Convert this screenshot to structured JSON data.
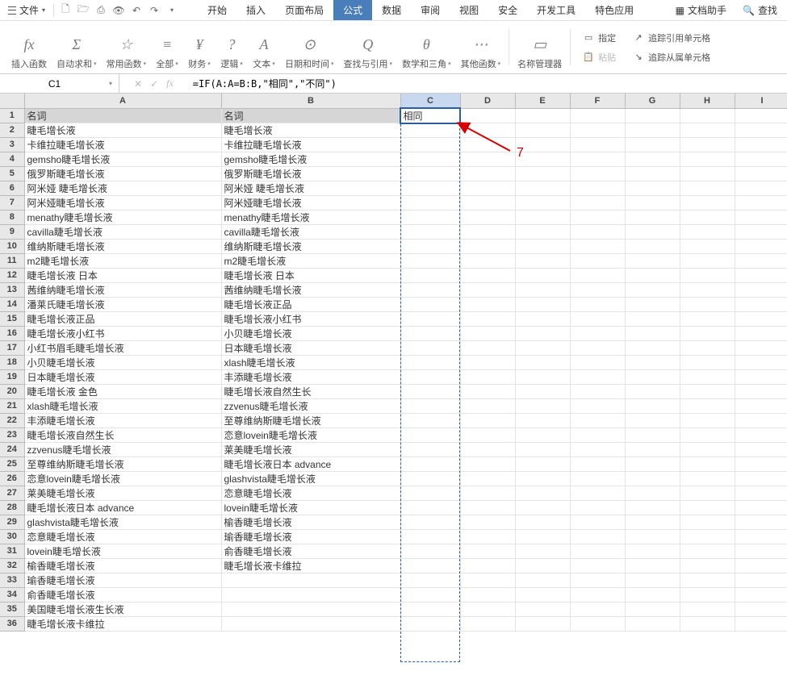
{
  "menubar": {
    "file_label": "文件",
    "qat": [
      "new",
      "open",
      "print",
      "preview",
      "undo",
      "redo"
    ]
  },
  "tabs": {
    "items": [
      "开始",
      "插入",
      "页面布局",
      "公式",
      "数据",
      "审阅",
      "视图",
      "安全",
      "开发工具",
      "特色应用"
    ],
    "active_index": 3
  },
  "right_tabs": {
    "doc_helper": "文档助手",
    "find": "查找"
  },
  "ribbon": {
    "groups": [
      {
        "icon": "fx",
        "label": "插入函数",
        "has_caret": false
      },
      {
        "icon": "Σ",
        "label": "自动求和",
        "has_caret": true
      },
      {
        "icon": "☆",
        "label": "常用函数",
        "has_caret": true
      },
      {
        "icon": "≡",
        "label": "全部",
        "has_caret": true
      },
      {
        "icon": "¥",
        "label": "财务",
        "has_caret": true
      },
      {
        "icon": "?",
        "label": "逻辑",
        "has_caret": true
      },
      {
        "icon": "A",
        "label": "文本",
        "has_caret": true
      },
      {
        "icon": "⊙",
        "label": "日期和时间",
        "has_caret": true
      },
      {
        "icon": "Q",
        "label": "查找与引用",
        "has_caret": true
      },
      {
        "icon": "θ",
        "label": "数学和三角",
        "has_caret": true
      },
      {
        "icon": "⋯",
        "label": "其他函数",
        "has_caret": true
      },
      {
        "icon": "▭",
        "label": "名称管理器",
        "has_caret": false
      }
    ],
    "right": {
      "assign": "指定",
      "paste": "粘贴",
      "trace_precedents": "追踪引用单元格",
      "trace_dependents": "追踪从属单元格"
    }
  },
  "formula_bar": {
    "name_box": "C1",
    "formula": "=IF(A:A=B:B,\"相同\",\"不同\")"
  },
  "sheet": {
    "columns_width": {
      "A": 244,
      "B": 222,
      "C": 74,
      "D": 68,
      "E": 68,
      "F": 68,
      "G": 68,
      "H": 68,
      "I": 68
    },
    "col_labels": [
      "A",
      "B",
      "C",
      "D",
      "E",
      "F",
      "G",
      "H",
      "I"
    ],
    "selected_col": "C",
    "active_cell": "C1",
    "rows": [
      {
        "n": 1,
        "a": "名词",
        "b": "名词",
        "c": "相同",
        "hdr": true
      },
      {
        "n": 2,
        "a": "睫毛增长液",
        "b": "睫毛增长液"
      },
      {
        "n": 3,
        "a": "卡维拉睫毛增长液",
        "b": "卡维拉睫毛增长液"
      },
      {
        "n": 4,
        "a": "gemsho睫毛增长液",
        "b": "gemsho睫毛增长液"
      },
      {
        "n": 5,
        "a": "俄罗斯睫毛增长液",
        "b": "俄罗斯睫毛增长液"
      },
      {
        "n": 6,
        "a": "阿米娅 睫毛增长液",
        "b": "阿米娅 睫毛增长液"
      },
      {
        "n": 7,
        "a": "阿米娅睫毛增长液",
        "b": "阿米娅睫毛增长液"
      },
      {
        "n": 8,
        "a": "menathy睫毛增长液",
        "b": "menathy睫毛增长液"
      },
      {
        "n": 9,
        "a": "cavilla睫毛增长液",
        "b": "cavilla睫毛增长液"
      },
      {
        "n": 10,
        "a": "维纳斯睫毛增长液",
        "b": "维纳斯睫毛增长液"
      },
      {
        "n": 11,
        "a": "m2睫毛增长液",
        "b": "m2睫毛增长液"
      },
      {
        "n": 12,
        "a": "睫毛增长液 日本",
        "b": "睫毛增长液 日本"
      },
      {
        "n": 13,
        "a": "茜维纳睫毛增长液",
        "b": "茜维纳睫毛增长液"
      },
      {
        "n": 14,
        "a": "潘莱氏睫毛增长液",
        "b": "睫毛增长液正品"
      },
      {
        "n": 15,
        "a": "睫毛增长液正品",
        "b": "睫毛增长液小红书"
      },
      {
        "n": 16,
        "a": "睫毛增长液小红书",
        "b": "小贝睫毛增长液"
      },
      {
        "n": 17,
        "a": "小红书眉毛睫毛增长液",
        "b": "日本睫毛增长液"
      },
      {
        "n": 18,
        "a": "小贝睫毛增长液",
        "b": "xlash睫毛增长液"
      },
      {
        "n": 19,
        "a": "日本睫毛增长液",
        "b": "丰添睫毛增长液"
      },
      {
        "n": 20,
        "a": "睫毛增长液 金色",
        "b": "睫毛增长液自然生长"
      },
      {
        "n": 21,
        "a": "xlash睫毛增长液",
        "b": "zzvenus睫毛增长液"
      },
      {
        "n": 22,
        "a": "丰添睫毛增长液",
        "b": "至尊维纳斯睫毛增长液"
      },
      {
        "n": 23,
        "a": "睫毛增长液自然生长",
        "b": "恋意lovein睫毛增长液"
      },
      {
        "n": 24,
        "a": "zzvenus睫毛增长液",
        "b": "莱美睫毛增长液"
      },
      {
        "n": 25,
        "a": "至尊维纳斯睫毛增长液",
        "b": "睫毛增长液日本 advance"
      },
      {
        "n": 26,
        "a": "恋意lovein睫毛增长液",
        "b": "glashvista睫毛增长液"
      },
      {
        "n": 27,
        "a": "莱美睫毛增长液",
        "b": "恋意睫毛增长液"
      },
      {
        "n": 28,
        "a": "睫毛增长液日本 advance",
        "b": "lovein睫毛增长液"
      },
      {
        "n": 29,
        "a": "glashvista睫毛增长液",
        "b": "榆香睫毛增长液"
      },
      {
        "n": 30,
        "a": "恋意睫毛增长液",
        "b": "瑜香睫毛增长液"
      },
      {
        "n": 31,
        "a": "lovein睫毛增长液",
        "b": "俞香睫毛增长液"
      },
      {
        "n": 32,
        "a": "榆香睫毛增长液",
        "b": "睫毛增长液卡维拉"
      },
      {
        "n": 33,
        "a": "瑜香睫毛增长液",
        "b": ""
      },
      {
        "n": 34,
        "a": "俞香睫毛增长液",
        "b": ""
      },
      {
        "n": 35,
        "a": "美国睫毛增长液生长液",
        "b": ""
      },
      {
        "n": 36,
        "a": "睫毛增长液卡维拉",
        "b": ""
      }
    ]
  },
  "annotation": {
    "number": "7"
  }
}
